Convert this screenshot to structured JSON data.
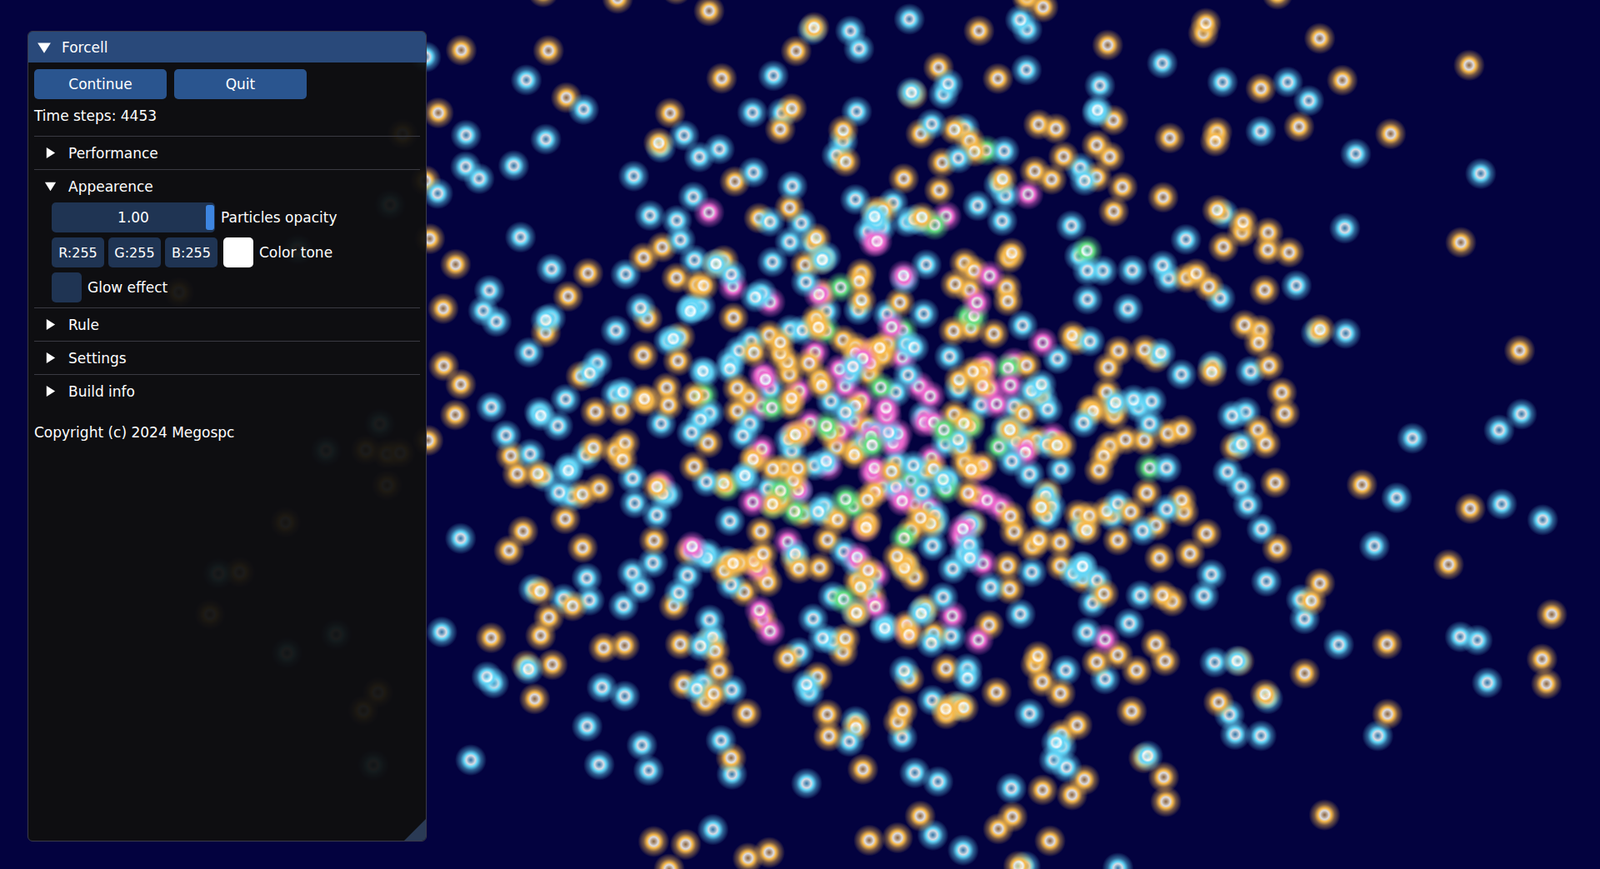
{
  "window": {
    "title": "Forcell",
    "expanded": true
  },
  "buttons": [
    {
      "label": "Continue"
    },
    {
      "label": "Quit"
    }
  ],
  "time_steps": "Time steps: 4453",
  "sections": [
    {
      "label": "Performance",
      "expanded": false,
      "controls": []
    },
    {
      "label": "Appearence",
      "expanded": true,
      "controls": [
        {
          "kind": "slider",
          "label": "Particles opacity",
          "value": "1.00",
          "level": 1
        },
        {
          "kind": "color",
          "label": "Color tone",
          "channels": [
            "R:255",
            "G:255",
            "B:255"
          ],
          "color": "#ffffff"
        },
        {
          "kind": "checkbox",
          "label": "Glow effect",
          "checked": false
        }
      ]
    },
    {
      "label": "Rule",
      "expanded": false,
      "controls": []
    },
    {
      "label": "Settings",
      "expanded": false,
      "controls": []
    },
    {
      "label": "Build info",
      "expanded": false,
      "controls": []
    }
  ],
  "copyright": "Copyright (c) 2024 Megospc",
  "simulation": {
    "species": [
      {
        "color": "#f7b94a"
      },
      {
        "color": "#62d6f7"
      },
      {
        "color": "#f06ad0"
      },
      {
        "color": "#62e080"
      }
    ]
  }
}
